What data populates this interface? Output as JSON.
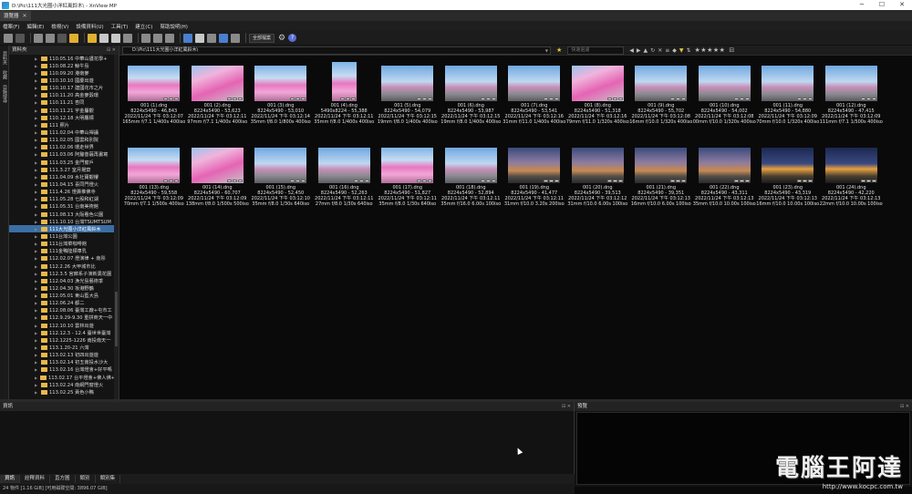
{
  "window": {
    "title": "D:\\Pic\\111大光圈小洋紅風鈴木\\ - XnView MP",
    "controls": [
      "─",
      "☐",
      "✕"
    ]
  },
  "tabs": [
    {
      "label": "瀏覽器",
      "close": "✕"
    }
  ],
  "menu": [
    "檔案(F)",
    "編輯(E)",
    "檢視(V)",
    "設備資料(U)",
    "工具(T)",
    "建立(C)",
    "幫助說明(H)"
  ],
  "toolbar": {
    "filter_select": "全部檔案",
    "icons": [
      "home-icon",
      "open-icon",
      "copy-icon",
      "move-icon",
      "delete-icon",
      "folder-up-icon",
      "rotate-left-icon",
      "rotate-right-icon",
      "slideshow-icon",
      "view-mode-icon",
      "sort-icon",
      "filter-icon",
      "map-icon",
      "binoculars-icon",
      "print-icon",
      "scanner-icon",
      "batch-icon",
      "settings-icon",
      "help-icon"
    ]
  },
  "folder_panel": {
    "title": "資料夾",
    "buttons": "⊟ ✕",
    "items": [
      {
        "label": "110.05.16 中華山護花學+",
        "state": "normal"
      },
      {
        "label": "110.08.22 鯨牛島",
        "state": "normal"
      },
      {
        "label": "110.09.20 港南麥",
        "state": "normal"
      },
      {
        "label": "110.10.10 國慶出遊",
        "state": "normal"
      },
      {
        "label": "110.10.17 建國花市之片",
        "state": "normal"
      },
      {
        "label": "110.11.20 高金麥穀環",
        "state": "normal"
      },
      {
        "label": "110.11.21 杏同",
        "state": "normal"
      },
      {
        "label": "110.11.21 宇金屬觀",
        "state": "normal"
      },
      {
        "label": "110.12.18 大明鷹標",
        "state": "normal"
      },
      {
        "label": "111 照片",
        "state": "normal"
      },
      {
        "label": "111.02.04 中華山禪誦",
        "state": "normal"
      },
      {
        "label": "111.02.05 國雲和別院",
        "state": "normal"
      },
      {
        "label": "111.02.06 環走世界",
        "state": "normal"
      },
      {
        "label": "111.03.06 阿釐菩薩再畫寫",
        "state": "normal"
      },
      {
        "label": "111.03.25 金門窗戶",
        "state": "normal"
      },
      {
        "label": "111.3.27 室月揚齋",
        "state": "normal"
      },
      {
        "label": "111.04.09 水社寶觀樓",
        "state": "normal"
      },
      {
        "label": "111.04.15 喜同門燈火",
        "state": "normal"
      },
      {
        "label": "111.4.26 燈壽推佛寺",
        "state": "normal"
      },
      {
        "label": "111.05.28 七股和紅湖",
        "state": "normal"
      },
      {
        "label": "111.05.31 台南美術館",
        "state": "normal"
      },
      {
        "label": "111.08.13 大阪看色公園",
        "state": "normal"
      },
      {
        "label": "111.10.10 台灣TSUMTSUM",
        "state": "normal"
      },
      {
        "label": "111大光圈小洋紅風鈴木",
        "state": "selected"
      },
      {
        "label": "111台灣公園",
        "state": "normal"
      },
      {
        "label": "111台灣菜咖啡館",
        "state": "normal"
      },
      {
        "label": "111金鴨陸標車乳",
        "state": "normal"
      },
      {
        "label": "112.02.07 燈演律 + 南彤",
        "state": "normal"
      },
      {
        "label": "112.2.26 大甲城市比",
        "state": "normal"
      },
      {
        "label": "112.3.5 宮廊系子演新奧花園",
        "state": "normal"
      },
      {
        "label": "112.04.03 漁光島藝術季",
        "state": "normal"
      },
      {
        "label": "112.04.30 坂港野鶴",
        "state": "normal"
      },
      {
        "label": "112.05.01 東山藍大島",
        "state": "normal"
      },
      {
        "label": "112.06.24 都二",
        "state": "normal"
      },
      {
        "label": "112.08.06 臺灣工廠+屯市工",
        "state": "normal"
      },
      {
        "label": "112.9.29-9.30 重拼商天一中",
        "state": "normal"
      },
      {
        "label": "112.10.10 雲林出遊",
        "state": "normal"
      },
      {
        "label": "112.12.3 - 12.4 臺世世臺灣",
        "state": "normal"
      },
      {
        "label": "112.1225-1226 南投南天一",
        "state": "normal"
      },
      {
        "label": "113.1.20-21 六灣",
        "state": "normal"
      },
      {
        "label": "113.02.13 初四出遊遊",
        "state": "normal"
      },
      {
        "label": "113.02.14 初五南投水沙大",
        "state": "normal"
      },
      {
        "label": "113.02.16 台灣燈會+好平嗎",
        "state": "normal"
      },
      {
        "label": "113.02.17 台平燈會+佛人佛+",
        "state": "normal"
      },
      {
        "label": "113.02.24 南網門窗燈火",
        "state": "normal"
      },
      {
        "label": "113.02.25 黃色小鴨",
        "state": "normal"
      }
    ]
  },
  "vertical_tabs": [
    "資料夾",
    "收藏",
    "目錄搜尋"
  ],
  "pathbar": {
    "path": "D:\\Pic\\111大光圈小洋紅風鈴木\\",
    "search_placeholder": "快速過濾",
    "rating_stars": "★★★★★",
    "rating_extra": "⊟"
  },
  "thumbnails": [
    {
      "name": "001 (1).dng",
      "size": "8224x5490 - 46,843",
      "date": "2022/11/24 下午 03:12:07",
      "exif": "165mm f/7.1 1/400s 400iso",
      "style": "blossom",
      "portrait": false
    },
    {
      "name": "001 (2).dng",
      "size": "8224x5490 - 53,623",
      "date": "2022/11/24 下午 03:12:11",
      "exif": "97mm f/7.1 1/400s 400iso",
      "style": "blossom2",
      "portrait": false
    },
    {
      "name": "001 (3).dng",
      "size": "8224x5490 - 53,010",
      "date": "2022/11/24 下午 03:12:14",
      "exif": "35mm f/8.0 1/800s 400iso",
      "style": "blossom",
      "portrait": false
    },
    {
      "name": "001 (4).dng",
      "size": "5490x8224 - 55,388",
      "date": "2022/11/24 下午 03:12:11",
      "exif": "35mm f/8.0 1/400s 400iso",
      "style": "blossom",
      "portrait": true
    },
    {
      "name": "001 (5).dng",
      "size": "8224x5490 - 54,079",
      "date": "2022/11/24 下午 03:12:15",
      "exif": "19mm f/8.0 1/400s 400iso",
      "style": "street",
      "portrait": false
    },
    {
      "name": "001 (6).dng",
      "size": "8224x5490 - 53,987",
      "date": "2022/11/24 下午 03:12:15",
      "exif": "19mm f/8.0 1/400s 400iso",
      "style": "street",
      "portrait": false
    },
    {
      "name": "001 (7).dng",
      "size": "8224x5490 - 53,541",
      "date": "2022/11/24 下午 03:12:16",
      "exif": "31mm f/11.0 1/400s 400iso",
      "style": "street",
      "portrait": false
    },
    {
      "name": "001 (8).dng",
      "size": "8224x5490 - 51,318",
      "date": "2022/11/24 下午 03:12:16",
      "exif": "79mm f/11.0 1/320s 400iso",
      "style": "blossom2",
      "portrait": false
    },
    {
      "name": "001 (9).dng",
      "size": "8224x5490 - 55,702",
      "date": "2022/11/24 下午 03:12:08",
      "exif": "16mm f/10.0 1/320s 400iso",
      "style": "street",
      "portrait": false
    },
    {
      "name": "001 (10).dng",
      "size": "8224x5490 - 54,002",
      "date": "2022/11/24 下午 03:12:08",
      "exif": "00mm f/10.0 1/320s 400iso",
      "style": "street",
      "portrait": false
    },
    {
      "name": "001 (11).dng",
      "size": "8224x5490 - 54,880",
      "date": "2022/11/24 下午 03:12:09",
      "exif": "70mm f/10.0 1/320s 400iso",
      "style": "street",
      "portrait": false
    },
    {
      "name": "001 (12).dng",
      "size": "8224x5490 - 47,415",
      "date": "2022/11/24 下午 03:12:09",
      "exif": "111mm f/7.1 1/500s 400iso",
      "style": "street",
      "portrait": false
    },
    {
      "name": "001 (13).dng",
      "size": "8224x5490 - 59,558",
      "date": "2022/11/24 下午 03:12:09",
      "exif": "70mm f/7.1 1/500s 400iso",
      "style": "blossom",
      "portrait": false
    },
    {
      "name": "001 (14).dng",
      "size": "8224x5490 - 60,707",
      "date": "2022/11/24 下午 03:12:09",
      "exif": "138mm f/8.0 1/500s 500iso",
      "style": "blossom2",
      "portrait": false
    },
    {
      "name": "001 (15).dng",
      "size": "8224x5490 - 52,450",
      "date": "2022/11/24 下午 03:12:10",
      "exif": "35mm f/8.0 1/30s 640iso",
      "style": "street",
      "portrait": false
    },
    {
      "name": "001 (16).dng",
      "size": "8224x5490 - 52,263",
      "date": "2022/11/24 下午 03:12:11",
      "exif": "27mm f/8.0 1/30s 640iso",
      "style": "street",
      "portrait": false
    },
    {
      "name": "001 (17).dng",
      "size": "8224x5490 - 51,827",
      "date": "2022/11/24 下午 03:12:11",
      "exif": "35mm f/8.0 1/30s 640iso",
      "style": "blossom",
      "portrait": false
    },
    {
      "name": "001 (18).dng",
      "size": "8224x5490 - 52,894",
      "date": "2022/11/24 下午 03:12:11",
      "exif": "35mm f/16.0 6.00s 100iso",
      "style": "street",
      "portrait": false
    },
    {
      "name": "001 (19).dng",
      "size": "8224x5490 - 41,477",
      "date": "2022/11/24 下午 03:12:11",
      "exif": "31mm f/10.0 3.20s 200iso",
      "style": "dusk",
      "portrait": false
    },
    {
      "name": "001 (20).dng",
      "size": "8224x5490 - 39,513",
      "date": "2022/11/24 下午 03:12:12",
      "exif": "31mm f/10.0 6.00s 100iso",
      "style": "dusk",
      "portrait": false
    },
    {
      "name": "001 (21).dng",
      "size": "8224x5490 - 39,351",
      "date": "2022/11/24 下午 03:12:13",
      "exif": "16mm f/10.0 6.00s 100iso",
      "style": "dusk",
      "portrait": false
    },
    {
      "name": "001 (22).dng",
      "size": "8224x5490 - 43,311",
      "date": "2022/11/24 下午 03:12:13",
      "exif": "35mm f/10.0 10.00s 100iso",
      "style": "dusk",
      "portrait": false
    },
    {
      "name": "001 (23).dng",
      "size": "8224x5490 - 43,319",
      "date": "2022/11/24 下午 03:12:13",
      "exif": "16mm f/10.0 10.00s 100iso",
      "style": "night",
      "portrait": false
    },
    {
      "name": "001 (24).dng",
      "size": "8224x5490 - 42,220",
      "date": "2022/11/24 下午 03:12:13",
      "exif": "22mm f/10.0 10.00s 100iso",
      "style": "night",
      "portrait": false
    }
  ],
  "info_panel": {
    "title": "資訊",
    "buttons": "⊟ ✕"
  },
  "preview_panel": {
    "title": "預覽",
    "buttons": "⊟ ✕"
  },
  "bottom_tabs": [
    "資訊",
    "詮釋資料",
    "直方圖",
    "類別",
    "類別集"
  ],
  "status": "24 物件 [1.16 GiB] [可用磁碟空間: 3896.07 GiB]",
  "watermark": {
    "brand": "電腦王阿達",
    "url": "http://www.kocpc.com.tw"
  }
}
